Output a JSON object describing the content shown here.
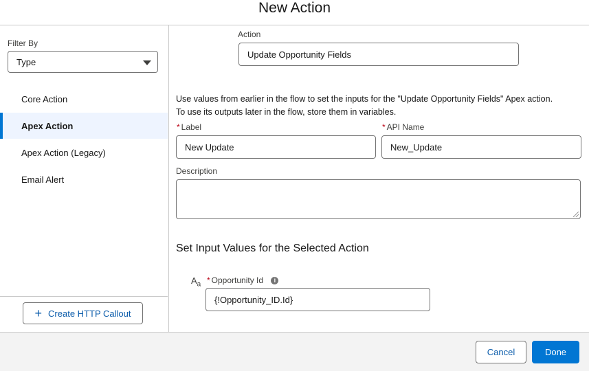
{
  "modal": {
    "title": "New Action"
  },
  "sidebar": {
    "filter_label": "Filter By",
    "filter_value": "Type",
    "items": [
      {
        "label": "Core Action",
        "active": false
      },
      {
        "label": "Apex Action",
        "active": true
      },
      {
        "label": "Apex Action (Legacy)",
        "active": false
      },
      {
        "label": "Email Alert",
        "active": false
      }
    ],
    "callout_button": "Create HTTP Callout"
  },
  "main": {
    "action_label": "Action",
    "action_value": "Update Opportunity Fields",
    "help_line1": "Use values from earlier in the flow to set the inputs for the \"Update Opportunity Fields\" Apex action.",
    "help_line2": "To use its outputs later in the flow, store them in variables.",
    "label_field_label": "Label",
    "label_field_value": "New Update",
    "api_name_label": "API Name",
    "api_name_value": "New_Update",
    "description_label": "Description",
    "description_value": "",
    "section_title": "Set Input Values for the Selected Action",
    "input_type_icon_main": "A",
    "input_type_icon_sub": "a",
    "opportunity_id_label": "Opportunity Id",
    "opportunity_id_value": "{!Opportunity_ID.Id}",
    "info_icon_glyph": "i",
    "required_marker": "*"
  },
  "footer": {
    "cancel_label": "Cancel",
    "done_label": "Done"
  },
  "colors": {
    "brand": "#0176d3",
    "active_bg": "#eef4ff",
    "required": "#ba0517",
    "footer_bg": "#f3f3f3"
  }
}
